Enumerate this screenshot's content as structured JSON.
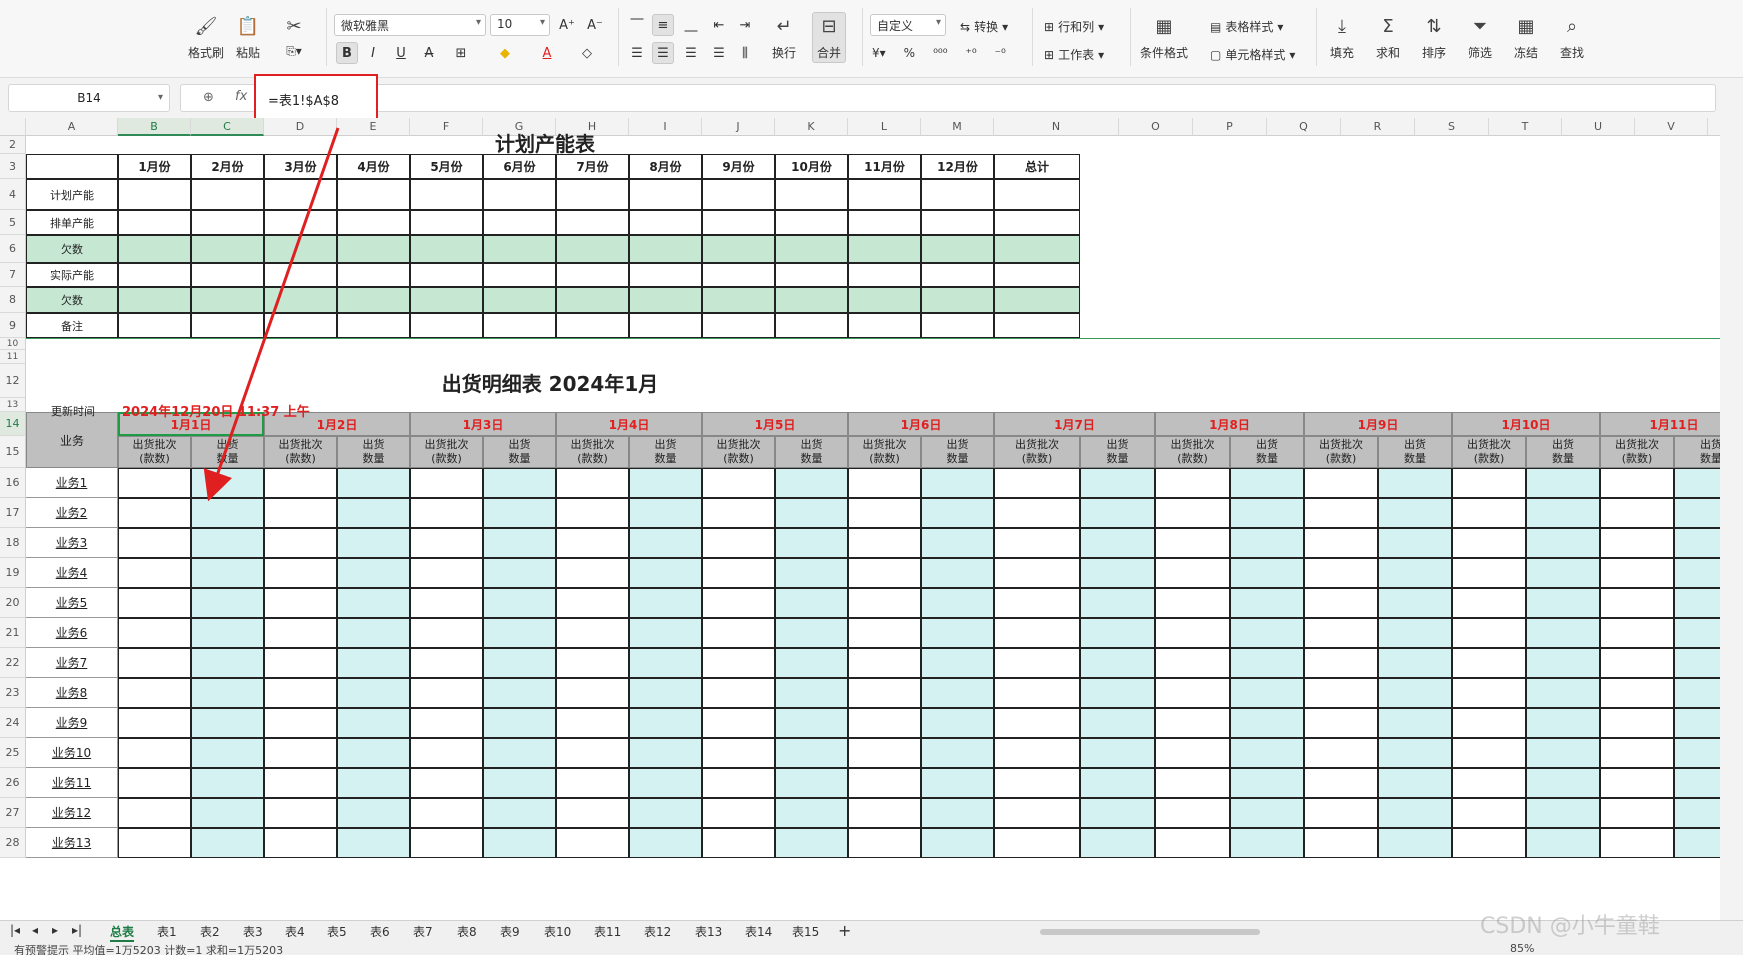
{
  "ribbon": {
    "format_painter": "格式刷",
    "paste": "粘贴",
    "font_name": "微软雅黑",
    "font_size": "10",
    "number_format": "自定义",
    "convert": "转换",
    "rows_cols": "行和列",
    "table_style": "表格样式",
    "wrap": "换行",
    "merge": "合并",
    "worksheet": "工作表",
    "cond_format": "条件格式",
    "cell_style": "单元格样式",
    "fill": "填充",
    "sum": "求和",
    "sort": "排序",
    "filter": "筛选",
    "freeze": "冻结",
    "find": "查找"
  },
  "formula_bar": {
    "name_box": "B14",
    "fx": "fx",
    "formula": "=表1!$A$8"
  },
  "columns": [
    "A",
    "B",
    "C",
    "D",
    "E",
    "F",
    "G",
    "H",
    "I",
    "J",
    "K",
    "L",
    "M",
    "N",
    "O",
    "P",
    "Q",
    "R",
    "S",
    "T",
    "U",
    "V",
    "W"
  ],
  "rows": [
    "2",
    "3",
    "4",
    "5",
    "6",
    "7",
    "8",
    "9",
    "10",
    "11",
    "12",
    "13",
    "14",
    "15",
    "16",
    "17",
    "18",
    "19",
    "20",
    "21",
    "22",
    "23",
    "24",
    "25",
    "26",
    "27",
    "28"
  ],
  "plan_table": {
    "title": "计划产能表",
    "months": [
      "1月份",
      "2月份",
      "3月份",
      "4月份",
      "5月份",
      "6月份",
      "7月份",
      "8月份",
      "9月份",
      "10月份",
      "11月份",
      "12月份",
      "总计"
    ],
    "row_labels": [
      "计划产能",
      "排单产能",
      "欠数",
      "实际产能",
      "欠数",
      "备注"
    ]
  },
  "ship_table": {
    "title": "出货明细表 2024年1月",
    "update_label": "更新时间",
    "update_value": "2024年12月20日 11:37 上午",
    "biz_header": "业务",
    "days": [
      "1月1日",
      "1月2日",
      "1月3日",
      "1月4日",
      "1月5日",
      "1月6日",
      "1月7日",
      "1月8日",
      "1月9日",
      "1月10日",
      "1月11日"
    ],
    "sub_a_1": "出货批次",
    "sub_a_2": "(款数)",
    "sub_b_1": "出货",
    "sub_b_2": "数量",
    "biz_rows": [
      "业务1",
      "业务2",
      "业务3",
      "业务4",
      "业务5",
      "业务6",
      "业务7",
      "业务8",
      "业务9",
      "业务10",
      "业务11",
      "业务12",
      "业务13"
    ]
  },
  "sheet_tabs": [
    "总表",
    "表1",
    "表2",
    "表3",
    "表4",
    "表5",
    "表6",
    "表7",
    "表8",
    "表9",
    "表10",
    "表11",
    "表12",
    "表13",
    "表14",
    "表15"
  ],
  "status": "有预警提示    平均值=1万5203  计数=1  求和=1万5203",
  "zoom": "85%",
  "watermark": "CSDN @小牛童鞋",
  "colors": {
    "accent": "#1e7b45",
    "red": "#e02020",
    "green_band": "#c6e8d3",
    "cyan_band": "#d5f2f2",
    "header_gray": "#bfbfbf"
  }
}
